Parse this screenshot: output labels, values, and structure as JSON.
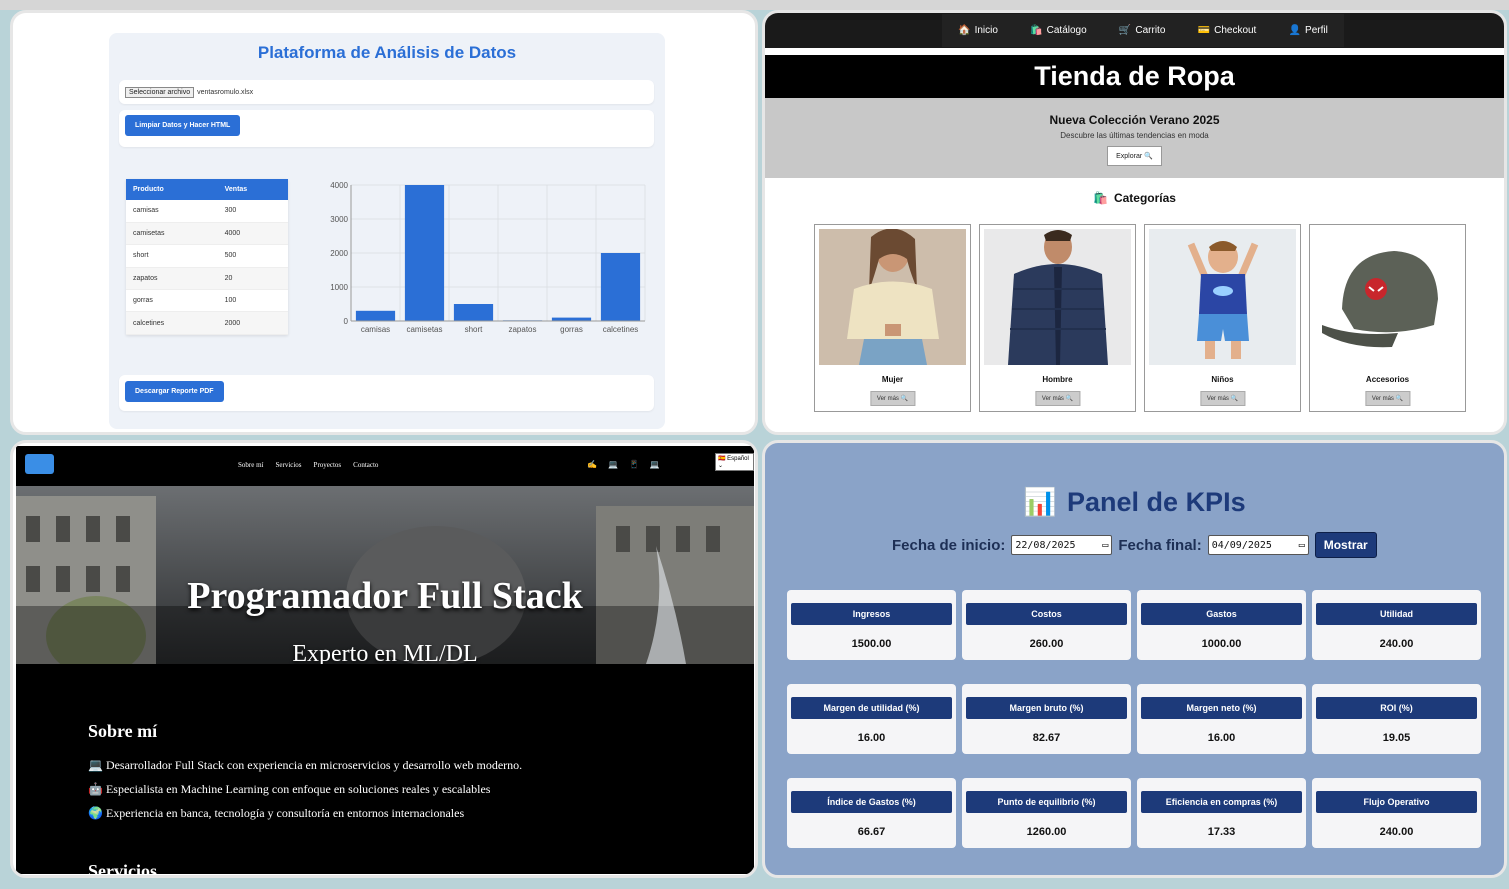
{
  "data_platform": {
    "title": "Plataforma de Análisis de Datos",
    "file_button": "Seleccionar archivo",
    "file_name": "ventasromulo.xlsx",
    "clean_button": "Limpiar Datos y Hacer HTML",
    "pdf_button": "Descargar Reporte PDF",
    "table": {
      "headers": [
        "Producto",
        "Ventas"
      ],
      "rows": [
        [
          "camisas",
          "300"
        ],
        [
          "camisetas",
          "4000"
        ],
        [
          "short",
          "500"
        ],
        [
          "zapatos",
          "20"
        ],
        [
          "gorras",
          "100"
        ],
        [
          "calcetines",
          "2000"
        ]
      ]
    },
    "chart_data": {
      "type": "bar",
      "categories": [
        "camisas",
        "camisetas",
        "short",
        "zapatos",
        "gorras",
        "calcetines"
      ],
      "values": [
        300,
        4000,
        500,
        20,
        100,
        2000
      ],
      "yticks": [
        "0",
        "1000",
        "2000",
        "3000",
        "4000"
      ],
      "ylim": [
        0,
        4000
      ],
      "grid": true,
      "bar_color": "#2b6fd6"
    }
  },
  "store": {
    "nav": [
      {
        "icon": "🏠",
        "label": "Inicio"
      },
      {
        "icon": "🛍️",
        "label": "Catálogo"
      },
      {
        "icon": "🛒",
        "label": "Carrito"
      },
      {
        "icon": "💳",
        "label": "Checkout"
      },
      {
        "icon": "👤",
        "label": "Perfil"
      }
    ],
    "title": "Tienda de Ropa",
    "hero_title": "Nueva Colección Verano 2025",
    "hero_subtitle": "Descubre las últimas tendencias en moda",
    "explore_button": "Explorar 🔍",
    "categories_icon": "🛍️",
    "categories_title": "Categorías",
    "categories": [
      {
        "name": "Mujer",
        "button": "Ver más 🔍"
      },
      {
        "name": "Hombre",
        "button": "Ver más 🔍"
      },
      {
        "name": "Niños",
        "button": "Ver más 🔍"
      },
      {
        "name": "Accesorios",
        "button": "Ver más 🔍"
      }
    ]
  },
  "portfolio": {
    "nav": [
      "Sobre mí",
      "Servicios",
      "Proyectos",
      "Contacto"
    ],
    "icons": [
      "✍",
      "💻",
      "📱",
      "💻"
    ],
    "language": "🇪🇸 Español ⌄",
    "hero_title": "Programador Full Stack",
    "hero_subtitle": "Experto en ML/DL",
    "about_title": "Sobre mí",
    "about_items": [
      "💻 Desarrollador Full Stack con experiencia en microservicios y desarrollo web moderno.",
      "🤖 Especialista en Machine Learning con enfoque en soluciones reales y escalables",
      "🌍 Experiencia en banca, tecnología y consultoría en entornos internacionales"
    ],
    "services_title": "Servicios"
  },
  "kpi": {
    "title_icon": "📊",
    "title": "Panel de KPIs",
    "start_label": "Fecha de inicio:",
    "start_value": "22/08/2025",
    "end_label": "Fecha final:",
    "end_value": "04/09/2025",
    "show_button": "Mostrar",
    "cards": [
      {
        "label": "Ingresos",
        "value": "1500.00"
      },
      {
        "label": "Costos",
        "value": "260.00"
      },
      {
        "label": "Gastos",
        "value": "1000.00"
      },
      {
        "label": "Utilidad",
        "value": "240.00"
      },
      {
        "label": "Margen de utilidad (%)",
        "value": "16.00"
      },
      {
        "label": "Margen bruto (%)",
        "value": "82.67"
      },
      {
        "label": "Margen neto (%)",
        "value": "16.00"
      },
      {
        "label": "ROI (%)",
        "value": "19.05"
      },
      {
        "label": "Índice de Gastos (%)",
        "value": "66.67"
      },
      {
        "label": "Punto de equilibrio (%)",
        "value": "1260.00"
      },
      {
        "label": "Eficiencia en compras (%)",
        "value": "17.33"
      },
      {
        "label": "Flujo Operativo",
        "value": "240.00"
      }
    ]
  }
}
